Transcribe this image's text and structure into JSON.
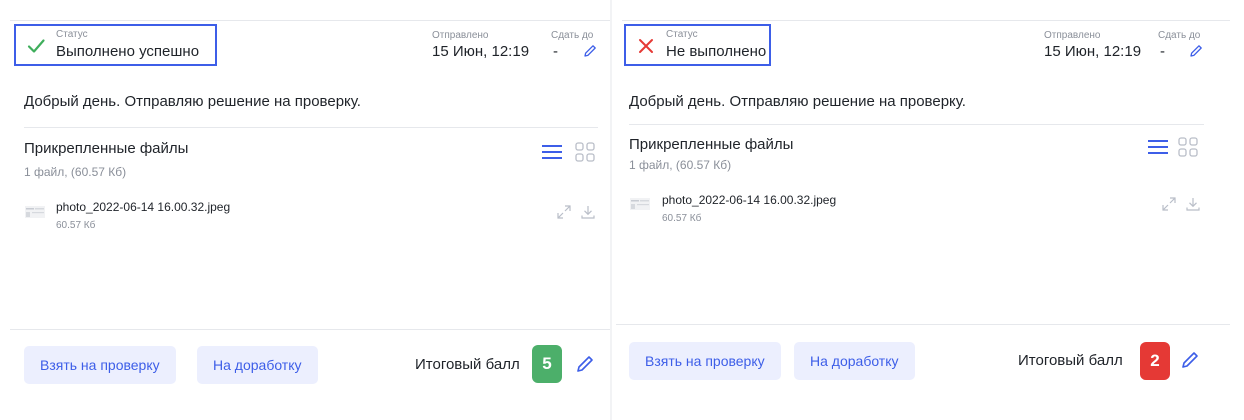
{
  "cards": [
    {
      "status_caption": "Статус",
      "status_value": "Выполнено успешно",
      "status_icon": "check-icon",
      "status_color": "#3fae5c",
      "sent_caption": "Отправлено",
      "sent_value": "15 Июн, 12:19",
      "deadline_caption": "Сдать до",
      "deadline_value": "-",
      "message": "Добрый день. Отправляю решение на проверку.",
      "files_title": "Прикрепленные файлы",
      "files_summary": "1 файл, (60.57 Кб)",
      "file_name": "photo_2022-06-14 16.00.32.jpeg",
      "file_size": "60.57 Кб",
      "review_button": "Взять на проверку",
      "rework_button": "На доработку",
      "score_label": "Итоговый балл",
      "score_value": "5",
      "score_color": "#4caf6a"
    },
    {
      "status_caption": "Статус",
      "status_value": "Не выполнено",
      "status_icon": "cross-icon",
      "status_color": "#e53935",
      "sent_caption": "Отправлено",
      "sent_value": "15 Июн, 12:19",
      "deadline_caption": "Сдать до",
      "deadline_value": "-",
      "message": "Добрый день. Отправляю решение на проверку.",
      "files_title": "Прикрепленные файлы",
      "files_summary": "1 файл, (60.57 Кб)",
      "file_name": "photo_2022-06-14 16.00.32.jpeg",
      "file_size": "60.57 Кб",
      "review_button": "Взять на проверку",
      "rework_button": "На доработку",
      "score_label": "Итоговый балл",
      "score_value": "2",
      "score_color": "#e53935"
    }
  ],
  "accent_color": "#3d5ee8"
}
